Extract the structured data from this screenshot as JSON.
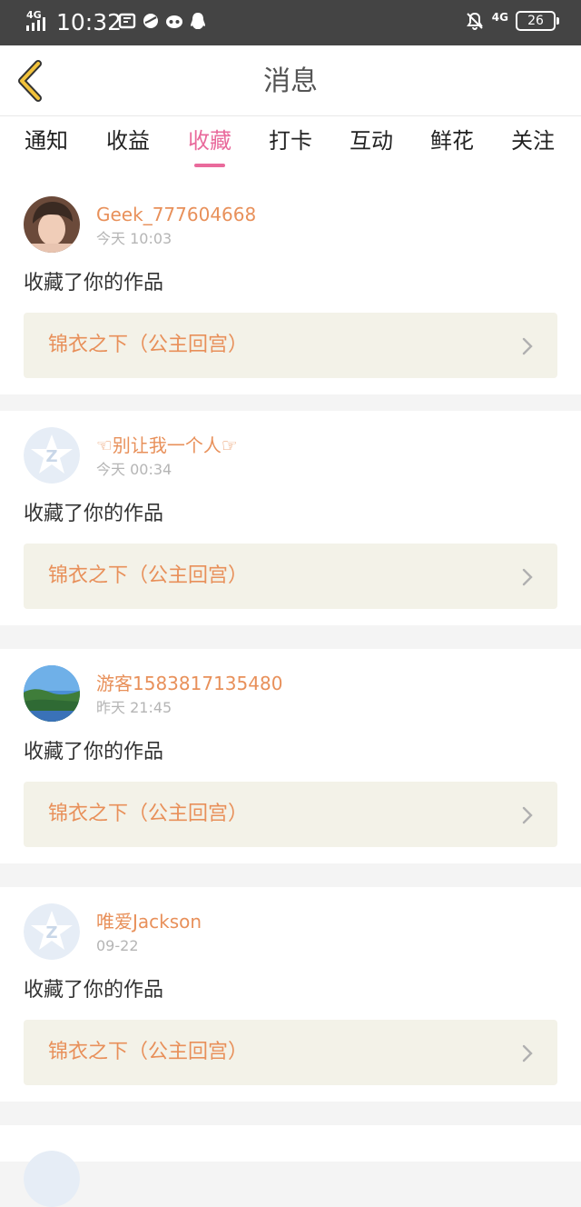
{
  "statusbar": {
    "network": "4G",
    "time": "10:32",
    "app_icons": [
      "screenshot-icon",
      "browser-icon",
      "game-icon",
      "qq-icon"
    ],
    "mute_icon": "bell-off-icon",
    "network_right": "4G",
    "battery": "26"
  },
  "header": {
    "title": "消息",
    "back_icon": "chevron-left-icon"
  },
  "tabs": [
    {
      "label": "通知",
      "active": false
    },
    {
      "label": "收益",
      "active": false
    },
    {
      "label": "收藏",
      "active": true
    },
    {
      "label": "打卡",
      "active": false
    },
    {
      "label": "互动",
      "active": false
    },
    {
      "label": "鲜花",
      "active": false
    },
    {
      "label": "关注",
      "active": false
    }
  ],
  "messages": [
    {
      "username": "Geek_777604668",
      "time": "今天 10:03",
      "action": "收藏了你的作品",
      "work": "锦衣之下（公主回宫）",
      "avatar": "photo-avatar"
    },
    {
      "username": "☜别让我一个人☞",
      "time": "今天 00:34",
      "action": "收藏了你的作品",
      "work": "锦衣之下（公主回宫）",
      "avatar": "default-avatar"
    },
    {
      "username": "游客1583817135480",
      "time": "昨天 21:45",
      "action": "收藏了你的作品",
      "work": "锦衣之下（公主回宫）",
      "avatar": "landscape-avatar"
    },
    {
      "username": "唯爱Jackson",
      "time": "09-22",
      "action": "收藏了你的作品",
      "work": "锦衣之下（公主回宫）",
      "avatar": "default-avatar"
    }
  ],
  "colors": {
    "accent_pink": "#e96a9c",
    "name_orange": "#e8905a",
    "work_bg": "#f3f2e8",
    "statusbar": "#444444"
  }
}
